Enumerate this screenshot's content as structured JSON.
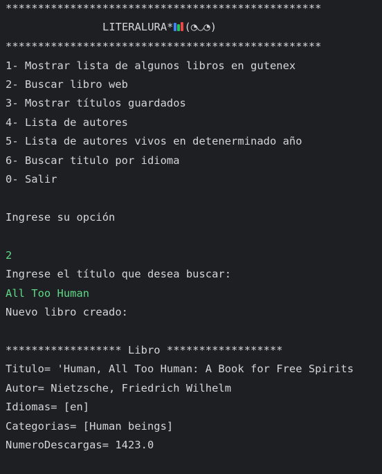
{
  "banner": {
    "top_rule": "*************************************************",
    "title_text": "LITERALURA*",
    "title_icon": "books-icon",
    "title_face": "(◔◡◔)",
    "bottom_rule": "*************************************************"
  },
  "menu": {
    "items": [
      "1- Mostrar lista de algunos libros en gutenex",
      "2- Buscar libro web",
      "3- Mostrar títulos guardados",
      "4- Lista de autores",
      "5- Lista de autores vivos en detenerminado año",
      "6- Buscar titulo por idioma",
      "0- Salir"
    ]
  },
  "prompt_option": "Ingrese su opción",
  "user_option_input": "2",
  "prompt_title": "Ingrese el título que desea buscar:",
  "user_title_input": "All Too Human",
  "created_message": "Nuevo libro creado:",
  "book_block": {
    "header": "****************** Libro ******************",
    "titulo": "Titulo= 'Human, All Too Human: A Book for Free Spirits",
    "autor": "Autor= Nietzsche, Friedrich Wilhelm",
    "idiomas": "Idiomas= [en]",
    "categorias": "Categorias= [Human beings]",
    "descargas": "NumeroDescargas= 1423.0"
  },
  "colors": {
    "background": "#1e1f22",
    "text": "#d4d6da",
    "user_input": "#5fd887"
  }
}
